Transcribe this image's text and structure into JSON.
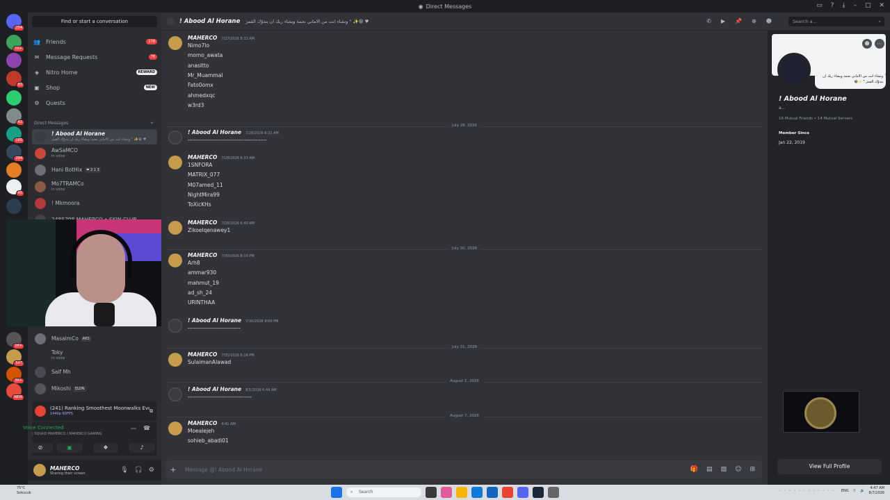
{
  "window": {
    "title": "Direct Messages"
  },
  "servers": [
    {
      "badge": "254"
    },
    {
      "badge": "1K+"
    },
    {
      "badge": ""
    },
    {
      "badge": "83"
    },
    {
      "badge": ""
    },
    {
      "badge": "42"
    },
    {
      "badge": "185"
    },
    {
      "badge": "294"
    },
    {
      "badge": ""
    },
    {
      "badge": "40"
    },
    {
      "badge": ""
    },
    {
      "badge": "1K+"
    },
    {
      "badge": "547"
    },
    {
      "badge": "3K+"
    },
    {
      "badge": "NEW"
    }
  ],
  "sidebar": {
    "find": "Find or start a conversation",
    "nav": [
      {
        "label": "Friends",
        "badge": "178"
      },
      {
        "label": "Message Requests",
        "badge": "76"
      },
      {
        "label": "Nitro Home",
        "badge": "REWARD"
      },
      {
        "label": "Shop",
        "badge": "NEW"
      },
      {
        "label": "Quests",
        "badge": ""
      }
    ],
    "dm_header": "Direct Messages",
    "dms": [
      {
        "name": "! Abood Al Horane",
        "sub": "وتشاء انت من الاماني نجمة ويشاء ربك ان يتذوّك القمرَ \" ✨😁 ♥",
        "tag": ""
      },
      {
        "name": "AwSaMCO",
        "sub": "In voice",
        "tag": ""
      },
      {
        "name": "Hani BotHix",
        "sub": "",
        "tag": "❤ 2 1 3"
      },
      {
        "name": "Mo7TRAMCo",
        "sub": "In voice",
        "tag": ""
      },
      {
        "name": "! Mkmoora",
        "sub": "",
        "tag": ""
      },
      {
        "name": "2485798 MAHERCO • SKIN CLUB",
        "sub": "",
        "tag": ""
      },
      {
        "name": "MasalmCo",
        "sub": "",
        "tag": "AKS"
      },
      {
        "name": "Toky",
        "sub": "In voice",
        "tag": ""
      },
      {
        "name": "Saif Mh",
        "sub": "",
        "tag": ""
      },
      {
        "name": "Mikoshi",
        "sub": "",
        "tag": "ELDN"
      }
    ],
    "media": {
      "title": "(241) Ranking Smoothest Moonwalks Ever...",
      "sub": "1440p 60FPS"
    },
    "voice": {
      "status": "Voice Connected",
      "channel": "| SQUAD MAHERCO / MAHERCO GAMING"
    },
    "user": {
      "name": "MAHERCO",
      "status": "Sharing their screen"
    }
  },
  "chat": {
    "header_name": "! Abood Al Horane",
    "header_status": "وتشاء انت من الاماني نجمة ويشاء ربك ان يتذوّك القمرَ \" ✨😁 ♥",
    "search_placeholder": "Search a...",
    "composer_placeholder": "Message @! Abood Al Horane",
    "messages": [
      {
        "author": "MAHERCO",
        "time": "7/27/2026 8:33 AM",
        "lines": [
          "Nimo7lo",
          "momo_awata",
          "anasitto",
          "Mr_Muammal",
          "Fato0omx",
          "ahmedxqc",
          "w3rd3"
        ]
      },
      {
        "divider": "July 28, 2026"
      },
      {
        "author": "! Abood Al Horane",
        "time": "7/28/2026 6:32 AM",
        "lines": [
          "------------------------------------------"
        ]
      },
      {
        "author": "MAHERCO",
        "time": "7/28/2026 6:33 AM",
        "lines": [
          "1SNFORA",
          "MATRIX_077",
          "M07amed_11",
          "NightMira99",
          "ToXicKHs"
        ]
      },
      {
        "author": "MAHERCO",
        "time": "7/28/2026 6:40 AM",
        "lines": [
          "Zikoelqenawey1"
        ]
      },
      {
        "divider": "July 30, 2026"
      },
      {
        "author": "MAHERCO",
        "time": "7/30/2026 8:10 PM",
        "lines": [
          "Arh8",
          "ammar930",
          "mahmut_19",
          "ad_sh_24",
          "URINTHAA"
        ]
      },
      {
        "author": "! Abood Al Horane",
        "time": "7/30/2026 9:09 PM",
        "lines": [
          "----------------------------"
        ]
      },
      {
        "divider": "July 31, 2026"
      },
      {
        "author": "MAHERCO",
        "time": "7/31/2026 6:16 PM",
        "lines": [
          "SulaimanAlawad"
        ]
      },
      {
        "divider": "August 1, 2026"
      },
      {
        "author": "! Abood Al Horane",
        "time": "8/1/2026 6:44 AM",
        "lines": [
          "----------------------------------"
        ]
      },
      {
        "divider": "August 7, 2026"
      },
      {
        "author": "MAHERCO",
        "time": "4:41 AM",
        "lines": [
          "Moealejeh",
          "sohieb_abadi01"
        ]
      }
    ]
  },
  "profile": {
    "name": "! Abood Al Horane",
    "bubble": "وتشاء انت من الاماني نجمة ويشاء ربك ان يتذوّك القمرَ \" ✨😁",
    "sub": "a...",
    "mutual": "16 Mutual Friends • 14 Mutual Servers",
    "member_since_label": "Member Since",
    "member_since": "Jan 22, 2019",
    "view_full": "View Full Profile"
  },
  "taskbar": {
    "weather_temp": "75°C",
    "weather_desc": "Sokucuk",
    "search": "Search",
    "lang": "ENG",
    "time": "4:47 AM",
    "date": "8/7/2026"
  },
  "colors": {
    "accent": "#5865f2",
    "danger": "#f23f43",
    "online": "#23a55a",
    "bg": "#313338"
  }
}
